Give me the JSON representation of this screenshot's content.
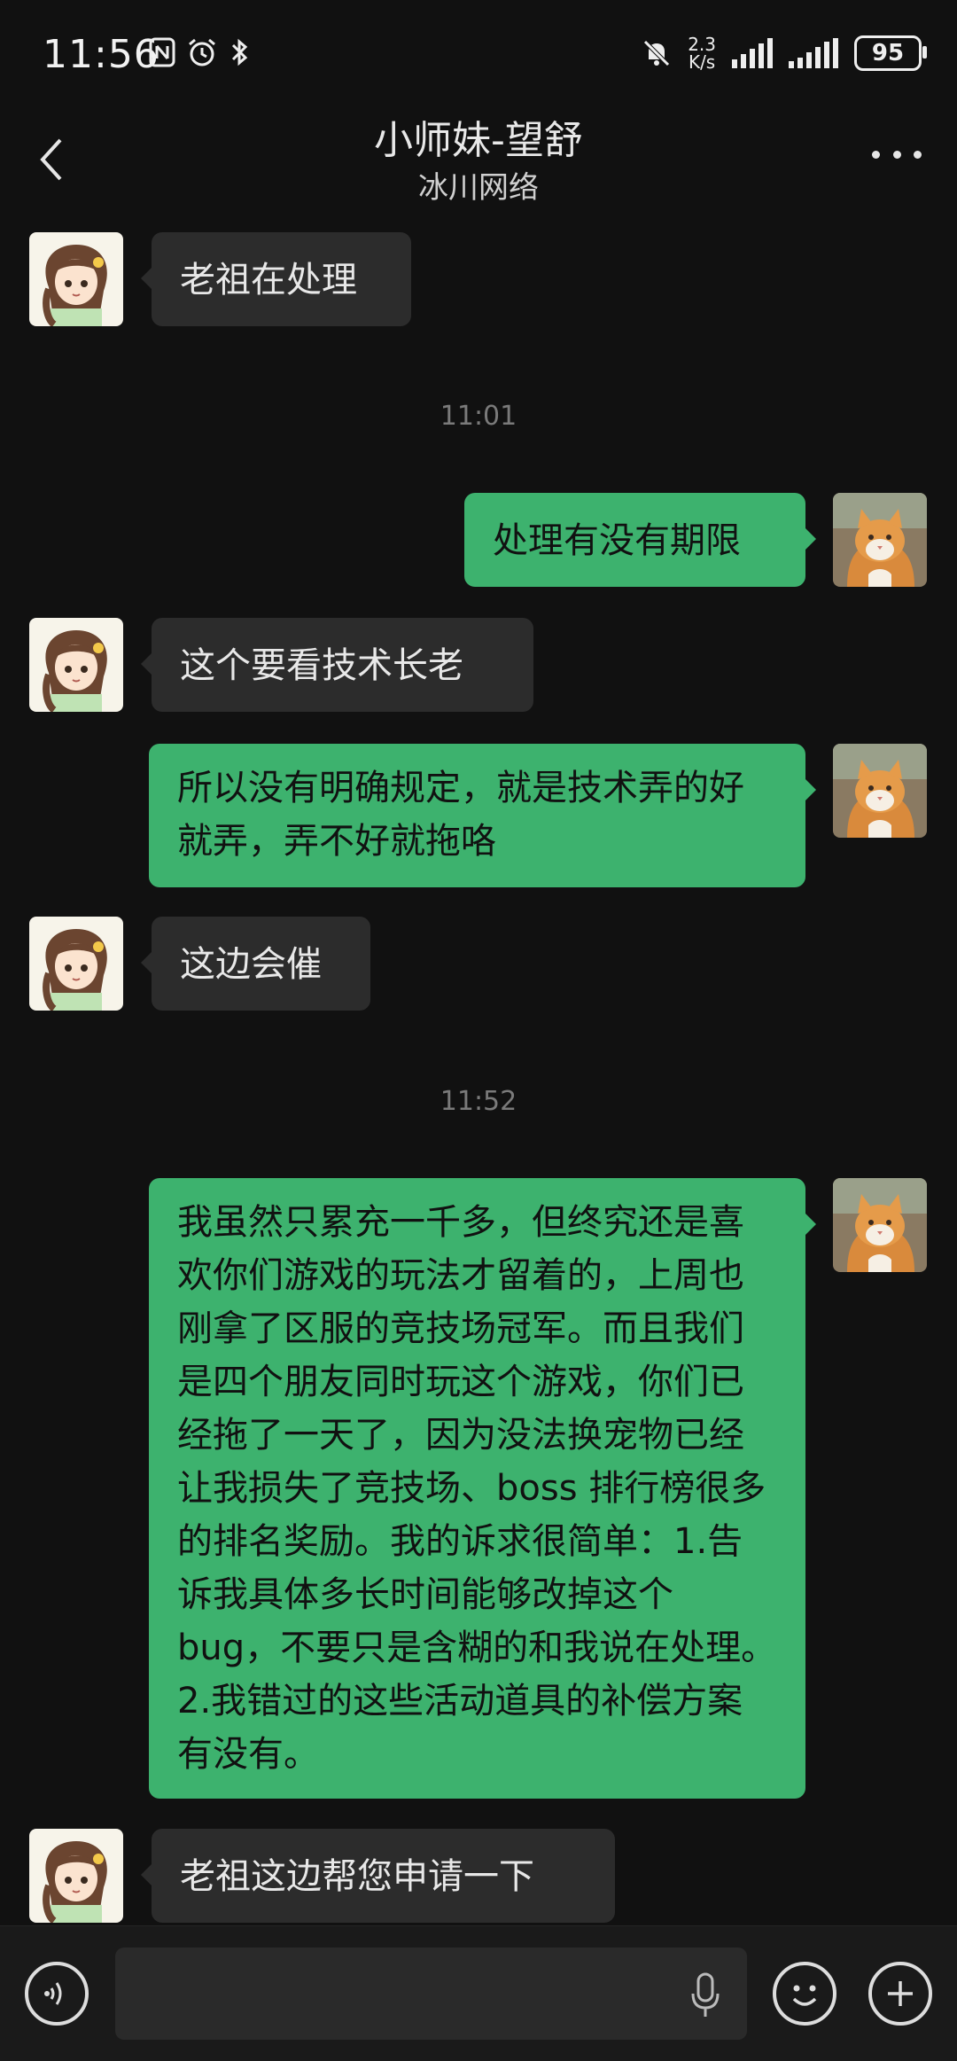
{
  "status_bar": {
    "time": "11:56",
    "net_speed_value": "2.3",
    "net_speed_unit": "K/s",
    "battery": "95",
    "left_icons": [
      "nfc-icon",
      "alarm-icon",
      "bluetooth-icon"
    ],
    "right_icons": [
      "mute-icon",
      "signal-icon",
      "signal-icon"
    ]
  },
  "header": {
    "title": "小师妹-望舒",
    "subtitle": "冰川网络"
  },
  "messages": {
    "m1": "老祖在处理",
    "t1": "11:01",
    "m2": "处理有没有期限",
    "m3": "这个要看技术长老",
    "m4": "所以没有明确规定，就是技术弄的好就弄，弄不好就拖咯",
    "m5": "这边会催",
    "t2": "11:52",
    "m6": "我虽然只累充一千多，但终究还是喜欢你们游戏的玩法才留着的，上周也刚拿了区服的竞技场冠军。而且我们是四个朋友同时玩这个游戏，你们已经拖了一天了，因为没法换宠物已经让我损失了竞技场、boss 排行榜很多的排名奖励。我的诉求很简单：1.告诉我具体多长时间能够改掉这个 bug，不要只是含糊的和我说在处理。2.我错过的这些活动道具的补偿方案有没有。",
    "m7": "老祖这边帮您申请一下"
  },
  "input": {
    "value": ""
  },
  "colors": {
    "background": "#111111",
    "incoming_bubble": "#2c2c2c",
    "outgoing_bubble": "#3db26e"
  }
}
